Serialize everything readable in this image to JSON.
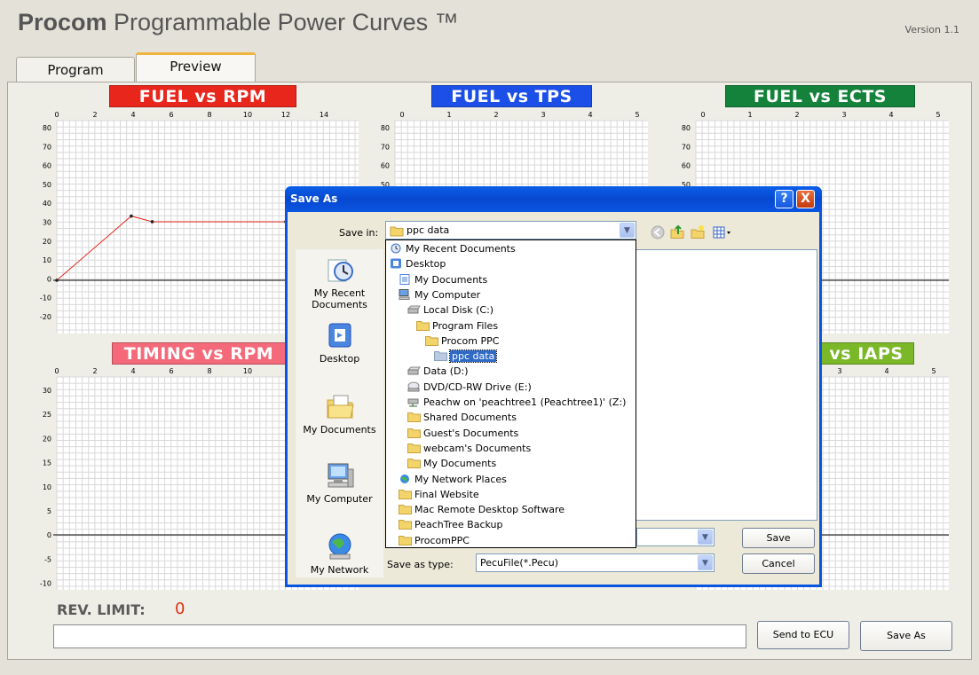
{
  "app": {
    "title_bold": "Procom",
    "title_rest": "Programmable Power Curves ™",
    "version": "Version 1.1"
  },
  "tabs": [
    "Program",
    "Preview"
  ],
  "charts": [
    {
      "id": "fuel-rpm",
      "title": "FUEL vs RPM",
      "color": "#e8261c",
      "xticks": [
        "0",
        "2",
        "4",
        "6",
        "8",
        "10",
        "12",
        "14"
      ],
      "yticks": [
        "80",
        "70",
        "60",
        "50",
        "40",
        "30",
        "20",
        "10",
        "0",
        "-10",
        "-20"
      ]
    },
    {
      "id": "fuel-tps",
      "title": "FUEL vs TPS",
      "color": "#1c4fe8",
      "xticks": [
        "0",
        "1",
        "2",
        "3",
        "4",
        "5"
      ],
      "yticks": [
        "80",
        "70",
        "60",
        "50"
      ]
    },
    {
      "id": "fuel-ects",
      "title": "FUEL vs ECTS",
      "color": "#14823a",
      "xticks": [
        "0",
        "1",
        "2",
        "3",
        "4",
        "5"
      ],
      "yticks": [
        "80",
        "70",
        "60",
        "50"
      ]
    },
    {
      "id": "timing-rpm",
      "title": "TIMING vs RPM",
      "color": "#f46a7a",
      "xticks": [
        "0",
        "2",
        "4",
        "6",
        "8",
        "10"
      ],
      "yticks": [
        "30",
        "25",
        "20",
        "15",
        "10",
        "5",
        "0",
        "-5",
        "-10"
      ]
    },
    {
      "id": "fuel-iaps",
      "title": "vs IAPS",
      "color": "#7ab828",
      "xticks": [
        "3",
        "4",
        "5"
      ],
      "yticks": []
    }
  ],
  "chart_data": {
    "type": "line",
    "title": "FUEL vs RPM",
    "x": [
      0,
      3.9,
      5,
      12
    ],
    "y": [
      0,
      34,
      31,
      31
    ],
    "xlim": [
      0,
      14
    ],
    "ylim": [
      -20,
      80
    ]
  },
  "rev_limit": {
    "label": "REV. LIMIT:",
    "value": "0"
  },
  "buttons": {
    "send_to_ecu": "Send to ECU",
    "save_as": "Save As"
  },
  "dialog": {
    "title": "Save As",
    "help": "?",
    "close": "X",
    "save_in_label": "Save in:",
    "save_in_value": "ppc data",
    "save_as_type_label": "Save as type:",
    "save_as_type_value": "PecuFile(*.Pecu)",
    "save_button": "Save",
    "cancel_button": "Cancel",
    "places": [
      "My Recent Documents",
      "Desktop",
      "My Documents",
      "My Computer",
      "My Network"
    ],
    "dropdown_items": [
      {
        "label": "My Recent Documents",
        "indent": 0,
        "icon": "recent-icon"
      },
      {
        "label": "Desktop",
        "indent": 0,
        "icon": "desktop-icon"
      },
      {
        "label": "My Documents",
        "indent": 1,
        "icon": "documents-icon"
      },
      {
        "label": "My Computer",
        "indent": 1,
        "icon": "computer-icon"
      },
      {
        "label": "Local Disk (C:)",
        "indent": 2,
        "icon": "drive-icon"
      },
      {
        "label": "Program Files",
        "indent": 3,
        "icon": "folder-icon"
      },
      {
        "label": "Procom PPC",
        "indent": 4,
        "icon": "folder-icon"
      },
      {
        "label": "ppc data",
        "indent": 5,
        "icon": "folder-open-icon",
        "selected": true
      },
      {
        "label": "Data (D:)",
        "indent": 2,
        "icon": "drive-icon"
      },
      {
        "label": "DVD/CD-RW Drive (E:)",
        "indent": 2,
        "icon": "cd-icon"
      },
      {
        "label": "Peachw on 'peachtree1 (Peachtree1)' (Z:)",
        "indent": 2,
        "icon": "network-drive-icon"
      },
      {
        "label": "Shared Documents",
        "indent": 2,
        "icon": "folder-icon"
      },
      {
        "label": "Guest's Documents",
        "indent": 2,
        "icon": "folder-icon"
      },
      {
        "label": "webcam's Documents",
        "indent": 2,
        "icon": "folder-icon"
      },
      {
        "label": "My Documents",
        "indent": 2,
        "icon": "folder-icon"
      },
      {
        "label": "My Network Places",
        "indent": 1,
        "icon": "network-icon"
      },
      {
        "label": "Final Website",
        "indent": 1,
        "icon": "folder-icon"
      },
      {
        "label": "Mac Remote Desktop Software",
        "indent": 1,
        "icon": "folder-icon"
      },
      {
        "label": "PeachTree Backup",
        "indent": 1,
        "icon": "folder-icon"
      },
      {
        "label": "ProcomPPC",
        "indent": 1,
        "icon": "folder-icon"
      }
    ]
  }
}
